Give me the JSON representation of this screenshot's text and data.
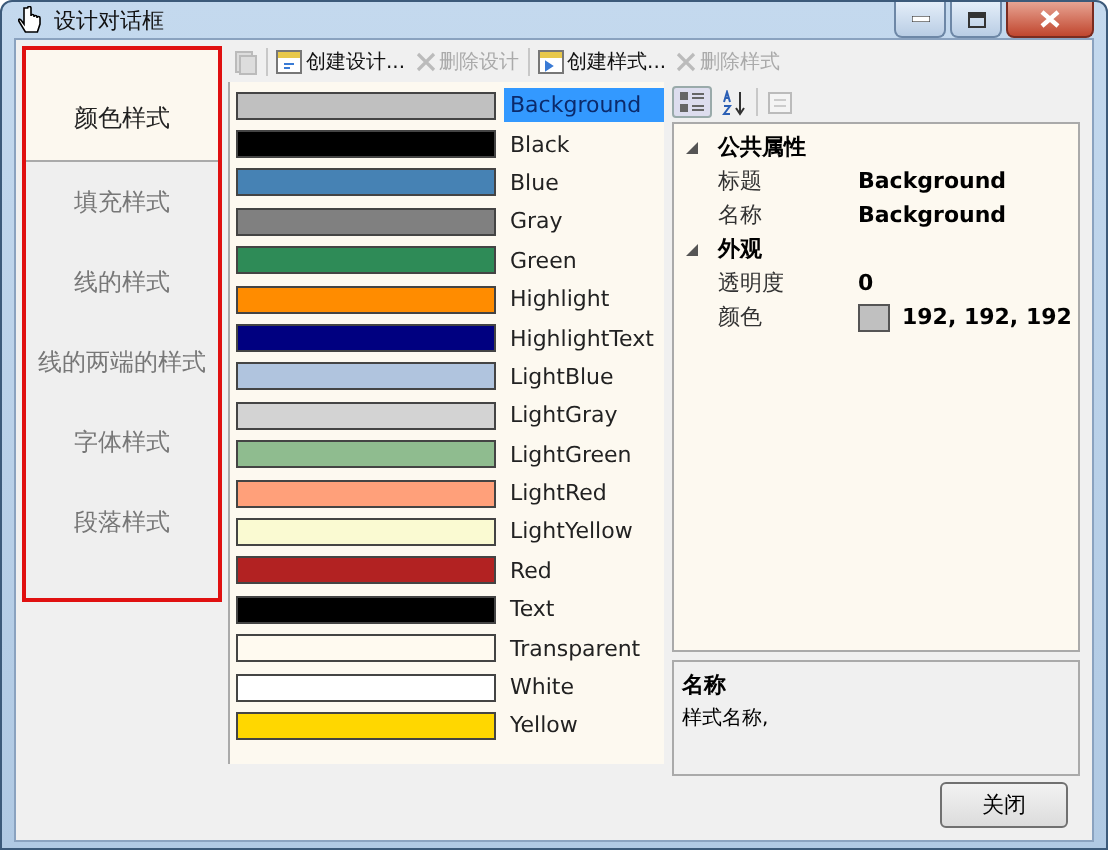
{
  "window": {
    "title": "设计对话框"
  },
  "sidebar": {
    "highlighted": true,
    "items": [
      {
        "label": "颜色样式",
        "selected": true
      },
      {
        "label": "填充样式",
        "selected": false
      },
      {
        "label": "线的样式",
        "selected": false
      },
      {
        "label": "线的两端的样式",
        "selected": false
      },
      {
        "label": "字体样式",
        "selected": false
      },
      {
        "label": "段落样式",
        "selected": false
      }
    ]
  },
  "toolbar": [
    {
      "kind": "disabled-icon",
      "disabled": true
    },
    {
      "kind": "create",
      "label": "创建设计...",
      "disabled": false
    },
    {
      "kind": "delete",
      "label": "删除设计",
      "disabled": true
    },
    {
      "kind": "create2",
      "label": "创建样式...",
      "disabled": false
    },
    {
      "kind": "delete",
      "label": "删除样式",
      "disabled": true
    }
  ],
  "colors": [
    {
      "name": "Background",
      "color": "#c0c0c0",
      "selected": true
    },
    {
      "name": "Black",
      "color": "#000000",
      "selected": false
    },
    {
      "name": "Blue",
      "color": "#4682b4",
      "selected": false
    },
    {
      "name": "Gray",
      "color": "#808080",
      "selected": false
    },
    {
      "name": "Green",
      "color": "#2e8b57",
      "selected": false
    },
    {
      "name": "Highlight",
      "color": "#ff8c00",
      "selected": false
    },
    {
      "name": "HighlightText",
      "color": "#000080",
      "selected": false
    },
    {
      "name": "LightBlue",
      "color": "#b0c4de",
      "selected": false
    },
    {
      "name": "LightGray",
      "color": "#d3d3d3",
      "selected": false
    },
    {
      "name": "LightGreen",
      "color": "#8fbc8f",
      "selected": false
    },
    {
      "name": "LightRed",
      "color": "#ffa07a",
      "selected": false
    },
    {
      "name": "LightYellow",
      "color": "#fafad2",
      "selected": false
    },
    {
      "name": "Red",
      "color": "#b22222",
      "selected": false
    },
    {
      "name": "Text",
      "color": "#000000",
      "selected": false
    },
    {
      "name": "Transparent",
      "color": "#fffaf0",
      "selected": false
    },
    {
      "name": "White",
      "color": "#ffffff",
      "selected": false
    },
    {
      "name": "Yellow",
      "color": "#ffd700",
      "selected": false
    }
  ],
  "properties": {
    "categories": [
      {
        "label": "公共属性",
        "expanded": true,
        "rows": [
          {
            "name": "标题",
            "value": "Background"
          },
          {
            "name": "名称",
            "value": "Background"
          }
        ]
      },
      {
        "label": "外观",
        "expanded": true,
        "rows": [
          {
            "name": "透明度",
            "value": "0"
          },
          {
            "name": "颜色",
            "value": "192, 192, 192",
            "color": "#c0c0c0"
          }
        ]
      }
    ]
  },
  "description": {
    "title": "名称",
    "text": "样式名称,"
  },
  "buttons": [
    "关闭"
  ]
}
